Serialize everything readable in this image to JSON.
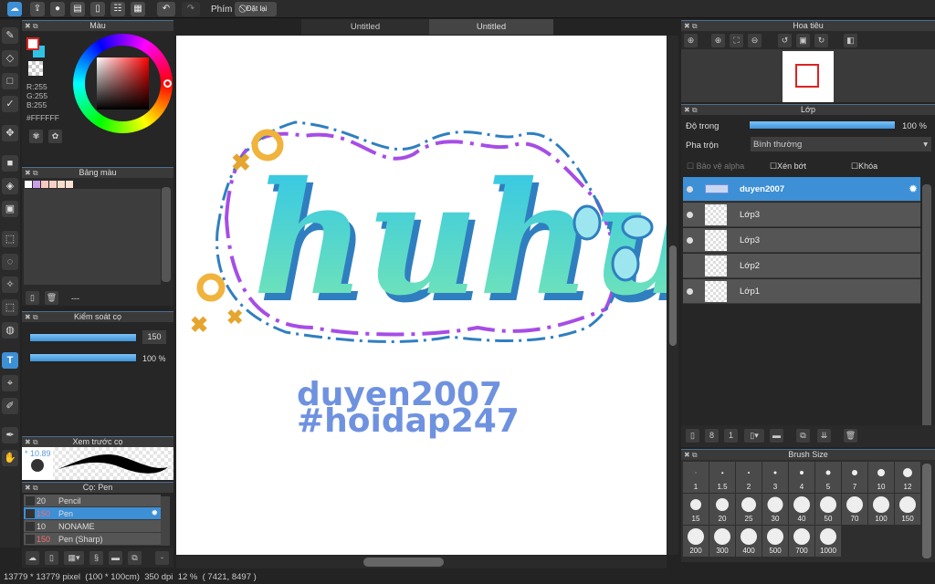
{
  "toolbar": {
    "shortcut_label": "Phím",
    "reset_label": "Đặt lại"
  },
  "tabs": [
    "Untitled",
    "Untitled"
  ],
  "color_panel": {
    "title": "Màu",
    "r": "R:255",
    "g": "G:255",
    "b": "B:255",
    "hex": "#FFFFFF",
    "primary": "#FFFFFF",
    "secondary": "#2ec4e6"
  },
  "palette_panel": {
    "title": "Bảng màu",
    "swatches": [
      "#ffffff",
      "#c9a0e8",
      "#f5c9c0",
      "#f6d2c4",
      "#f8dccb",
      "#f9e1d3"
    ],
    "footer_label": "---"
  },
  "brush_control": {
    "title": "Kiểm soát cọ",
    "size_value": "150",
    "opacity_value": "100 %"
  },
  "brush_preview": {
    "title": "Xem trước cọ",
    "size": "* 10.89"
  },
  "brush_list": {
    "title": "Cọ: Pen",
    "items": [
      {
        "size": "20",
        "name": "Pencil"
      },
      {
        "size": "150",
        "name": "Pen"
      },
      {
        "size": "10",
        "name": "NONAME"
      },
      {
        "size": "150",
        "name": "Pen (Sharp)"
      }
    ]
  },
  "navigator": {
    "title": "Hoa tiêu"
  },
  "layer_panel": {
    "title": "Lớp",
    "opacity_label": "Độ trong",
    "opacity_value": "100 %",
    "opacity": 1.0,
    "blend_label": "Pha trộn",
    "blend_value": "Bình thường",
    "protect_alpha": "Bảo vệ alpha",
    "clip": "Xén bớt",
    "lock": "Khóa",
    "layers": [
      {
        "name": "duyen2007",
        "visible": true
      },
      {
        "name": "Lớp3",
        "visible": true
      },
      {
        "name": "Lớp3",
        "visible": true
      },
      {
        "name": "Lớp2",
        "visible": false
      },
      {
        "name": "Lớp1",
        "visible": true
      }
    ]
  },
  "brush_size": {
    "title": "Brush Size",
    "sizes": [
      "1",
      "1.5",
      "2",
      "3",
      "4",
      "5",
      "7",
      "10",
      "12",
      "15",
      "20",
      "25",
      "30",
      "40",
      "50",
      "70",
      "100",
      "150",
      "200",
      "300",
      "400",
      "500",
      "700",
      "1000"
    ]
  },
  "canvas": {
    "art_text": "huhu",
    "line1": "duyen2007",
    "line2": "#hoidap247"
  },
  "status": {
    "size": "13779 * 13779 pixel",
    "physical": "(100 * 100cm)",
    "dpi": "350 dpi",
    "zoom": "12 %",
    "coords": "( 7421, 8497 )"
  },
  "hidden_scroll_value": "200"
}
